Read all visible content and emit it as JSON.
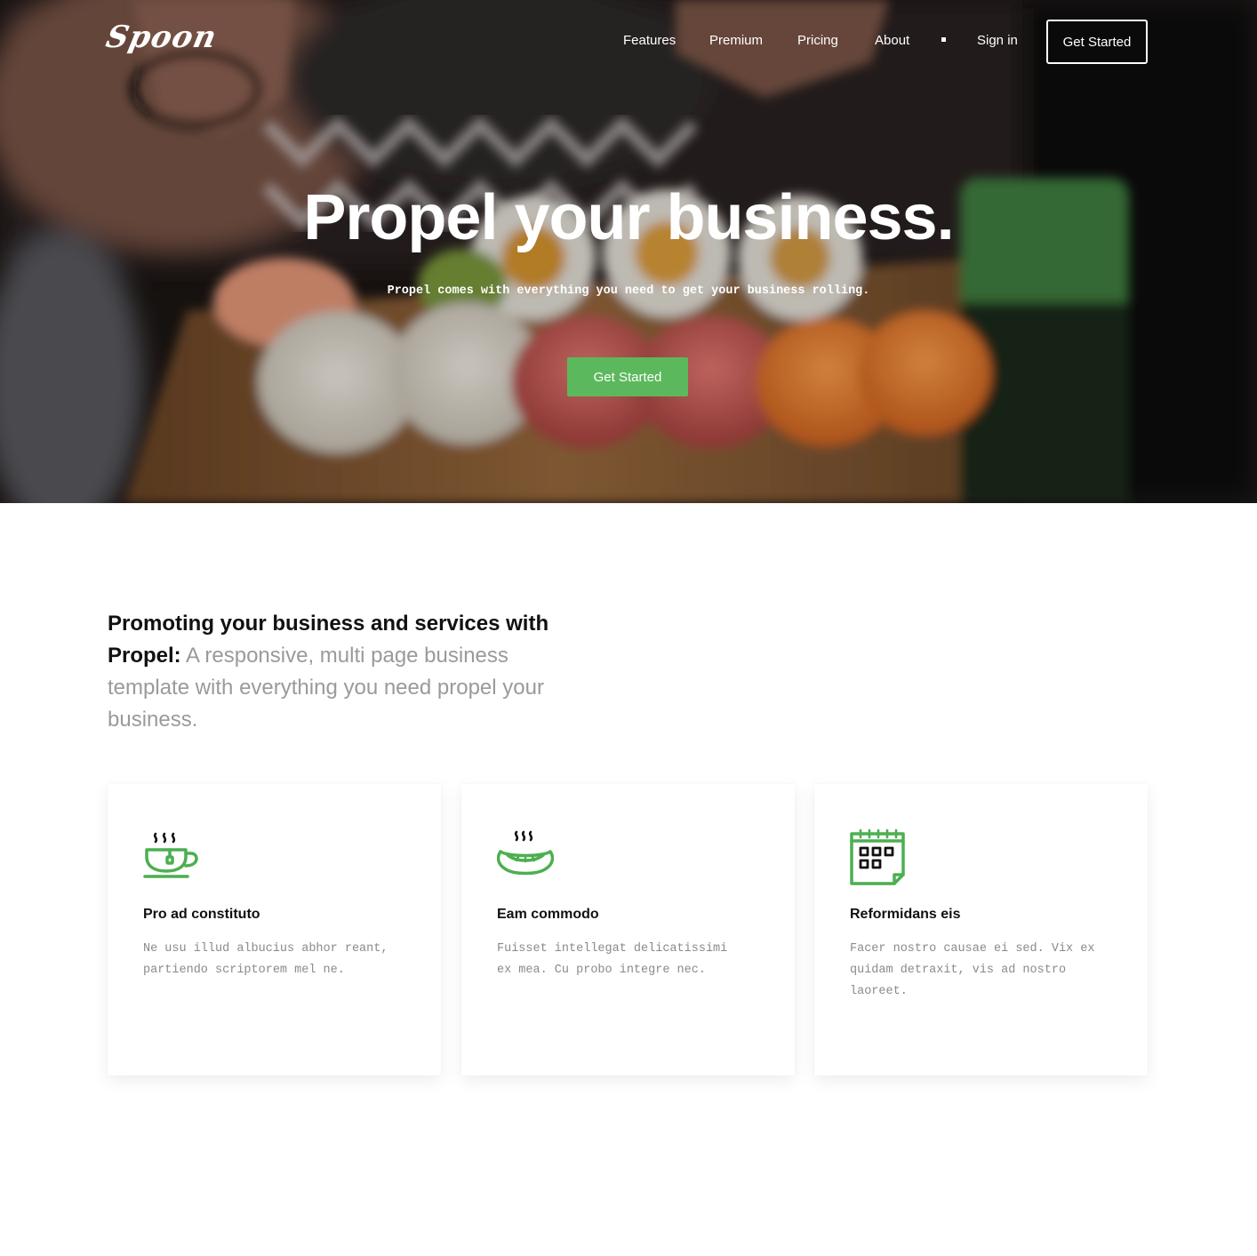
{
  "brand": {
    "logo_text": "Spoon"
  },
  "nav": {
    "items": [
      "Features",
      "Premium",
      "Pricing",
      "About"
    ],
    "signin": "Sign in",
    "cta": "Get Started"
  },
  "hero": {
    "title": "Propel your business.",
    "subtitle": "Propel comes with everything you need to get your business rolling.",
    "button": "Get Started"
  },
  "intro": {
    "strong": "Promoting your business and services with Propel:",
    "light": "A responsive, multi page business template with everything you need propel your business."
  },
  "cards": [
    {
      "icon": "tea-cup-icon",
      "title": "Pro ad constituto",
      "text": "Ne usu illud albucius abhor reant, partiendo scriptorem mel ne."
    },
    {
      "icon": "hot-food-icon",
      "title": "Eam commodo",
      "text": "Fuisset intellegat delicatissimi ex mea. Cu probo integre nec."
    },
    {
      "icon": "calendar-icon",
      "title": "Reformidans eis",
      "text": "Facer nostro causae ei sed. Vix ex quidam detraxit, vis ad nostro laoreet."
    }
  ],
  "colors": {
    "accent": "#5cb85c",
    "icon": "#4caf50"
  }
}
